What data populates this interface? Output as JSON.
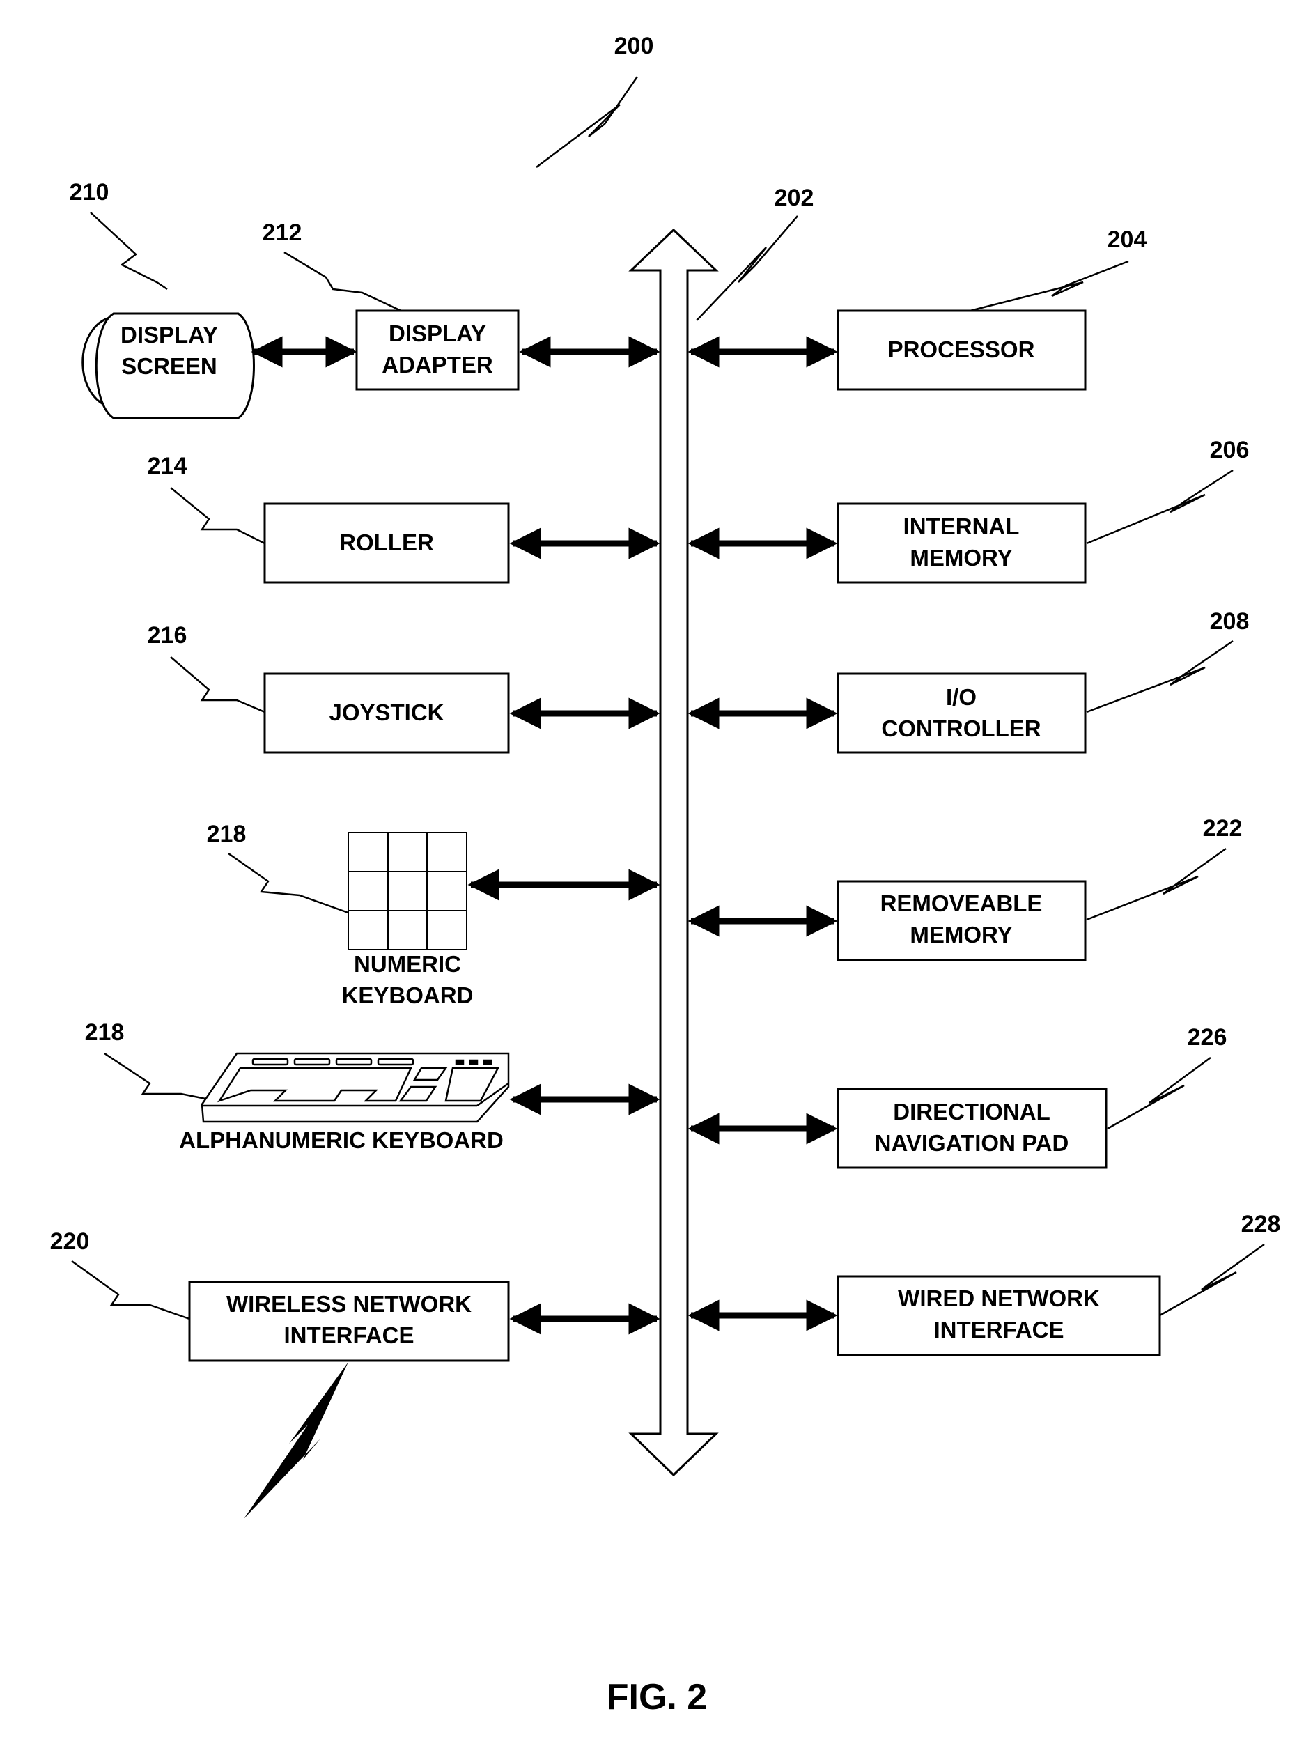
{
  "figure": {
    "title": "FIG. 2",
    "system_ref": "200",
    "bus_ref": "202"
  },
  "left_components": [
    {
      "ref": "210",
      "lines": [
        "DISPLAY",
        "SCREEN"
      ],
      "shape": "display-screen"
    },
    {
      "ref": "212",
      "lines": [
        "DISPLAY",
        "ADAPTER"
      ],
      "shape": "box"
    },
    {
      "ref": "214",
      "lines": [
        "ROLLER"
      ],
      "shape": "box"
    },
    {
      "ref": "216",
      "lines": [
        "JOYSTICK"
      ],
      "shape": "box"
    },
    {
      "ref": "218",
      "lines": [
        "NUMERIC",
        "KEYBOARD"
      ],
      "shape": "keypad"
    },
    {
      "ref": "218",
      "lines": [
        "ALPHANUMERIC KEYBOARD"
      ],
      "shape": "keyboard"
    },
    {
      "ref": "220",
      "lines": [
        "WIRELESS NETWORK",
        "INTERFACE"
      ],
      "shape": "box"
    }
  ],
  "right_components": [
    {
      "ref": "204",
      "lines": [
        "PROCESSOR"
      ]
    },
    {
      "ref": "206",
      "lines": [
        "INTERNAL",
        "MEMORY"
      ]
    },
    {
      "ref": "208",
      "lines": [
        "I/O",
        "CONTROLLER"
      ]
    },
    {
      "ref": "222",
      "lines": [
        "REMOVEABLE",
        "MEMORY"
      ]
    },
    {
      "ref": "226",
      "lines": [
        "DIRECTIONAL",
        "NAVIGATION PAD"
      ]
    },
    {
      "ref": "228",
      "lines": [
        "WIRED NETWORK",
        "INTERFACE"
      ]
    }
  ]
}
